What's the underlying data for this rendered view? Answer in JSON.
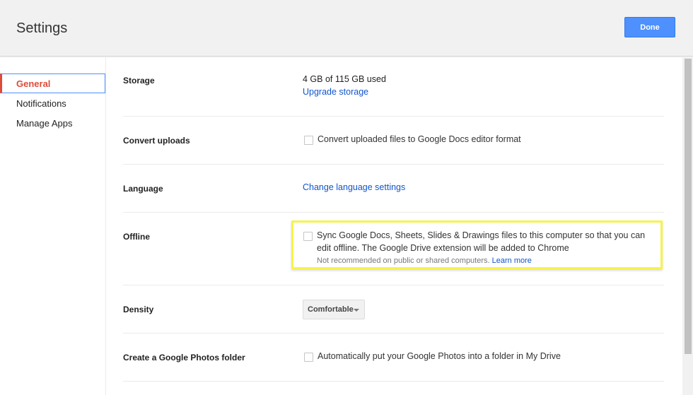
{
  "header": {
    "title": "Settings",
    "done_label": "Done"
  },
  "sidebar": {
    "items": [
      {
        "label": "General"
      },
      {
        "label": "Notifications"
      },
      {
        "label": "Manage Apps"
      }
    ]
  },
  "settings": {
    "storage": {
      "label": "Storage",
      "usage": "4 GB of 115 GB used",
      "upgrade_link": "Upgrade storage"
    },
    "convert": {
      "label": "Convert uploads",
      "checkbox_label": "Convert uploaded files to Google Docs editor format"
    },
    "language": {
      "label": "Language",
      "link": "Change language settings"
    },
    "offline": {
      "label": "Offline",
      "line1": "Sync Google Docs, Sheets, Slides & Drawings files to this computer so that you can",
      "line2": "edit offline. The Google Drive extension will be added to Chrome",
      "note": "Not recommended on public or shared computers.",
      "learn_more": "Learn more",
      "highlight_color": "#f7f34a"
    },
    "density": {
      "label": "Density",
      "selected": "Comfortable"
    },
    "photos": {
      "label": "Create a Google Photos folder",
      "checkbox_label": "Automatically put your Google Photos into a folder in My Drive"
    }
  },
  "colors": {
    "accent": "#4d90fe",
    "active_nav": "#dd4b39",
    "link": "#1155cc"
  }
}
